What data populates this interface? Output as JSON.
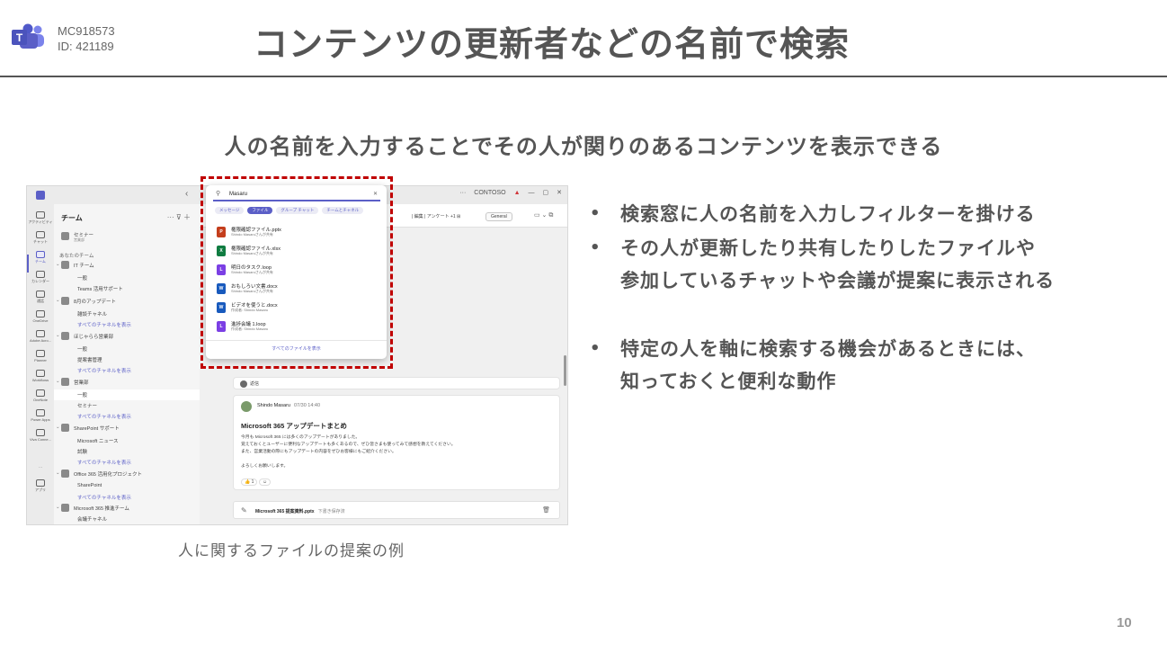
{
  "header": {
    "message_center_id": "MC918573",
    "roadmap_id": "ID: 421189",
    "title": "コンテンツの更新者などの名前で検索"
  },
  "subtitle": "人の名前を入力することでその人が関りのあるコンテンツを表示できる",
  "bullets": [
    {
      "lines": [
        "検索窓に人の名前を入力しフィルターを掛ける"
      ]
    },
    {
      "lines": [
        "その人が更新したり共有したりしたファイルや",
        "参加しているチャットや会議が提案に表示される"
      ]
    },
    {
      "lines": [
        "特定の人を軸に検索する機会があるときには、",
        "知っておくと便利な動作"
      ]
    }
  ],
  "caption": "人に関するファイルの提案の例",
  "page_number": "10",
  "colors": {
    "teams_purple": "#5b5fc7",
    "highlight_red": "#c00000",
    "heading_gray": "#555555"
  },
  "screenshot": {
    "titlebar": {
      "back": "‹",
      "more": "···",
      "tenant": "CONTOSO",
      "warn": "▲"
    },
    "rail": [
      {
        "label": "アクティビティ",
        "icon": "bell-icon"
      },
      {
        "label": "チャット",
        "icon": "chat-icon"
      },
      {
        "label": "チーム",
        "icon": "teams-icon"
      },
      {
        "label": "カレンダー",
        "icon": "calendar-icon"
      },
      {
        "label": "通話",
        "icon": "phone-icon"
      },
      {
        "label": "OneDrive",
        "icon": "cloud-icon"
      },
      {
        "label": "Adobe Acro...",
        "icon": "acrobat-icon"
      },
      {
        "label": "Planner",
        "icon": "planner-icon"
      },
      {
        "label": "Workflows",
        "icon": "workflow-icon"
      },
      {
        "label": "OneNote",
        "icon": "onenote-icon"
      },
      {
        "label": "Power Apps",
        "icon": "powerapps-icon"
      },
      {
        "label": "Viva Conne...",
        "icon": "viva-icon"
      },
      {
        "label": "アプリ",
        "icon": "apps-icon"
      }
    ],
    "team_list": {
      "heading": "チーム",
      "tools": "··· ⊽ ＋",
      "top_item": {
        "name": "セミナー",
        "sub": "営業部"
      },
      "group_label": "あなたのチーム",
      "teams": [
        {
          "name": "IT チーム",
          "channels": [
            "一般",
            "Teams 活用サポート"
          ],
          "all": ""
        },
        {
          "name": "8月のアップデート",
          "channels": [
            "雑談チャネル"
          ],
          "all": "すべてのチャネルを表示"
        },
        {
          "name": "ほじゃらら営業部",
          "channels": [
            "一般",
            "提案書管理"
          ],
          "all": "すべてのチャネルを表示"
        },
        {
          "name": "営業部",
          "channels": [
            "一般",
            "セミナー"
          ],
          "all": "すべてのチャネルを表示"
        },
        {
          "name": "SharePoint サポート",
          "channels": [
            "Microsoft ニュース",
            "試験"
          ],
          "all": "すべてのチャネルを表示"
        },
        {
          "name": "Office 365 活用化プロジェクト",
          "channels": [
            "SharePoint"
          ],
          "all": "すべてのチャネルを表示"
        },
        {
          "name": "Microsoft 365 推進チーム",
          "channels": [
            "会議チャネル"
          ],
          "all": "すべてのチャネルを表示"
        }
      ]
    },
    "channel_header": {
      "name": "一般",
      "tabs": "| 編集 | アンケート +1 ⊞",
      "general_button": "General",
      "icons": "▭ ⌄ ⧉"
    },
    "search": {
      "query": "Masaru",
      "clear": "✕",
      "chips": [
        {
          "label": "メッセージ",
          "active": false
        },
        {
          "label": "ファイル",
          "active": true
        },
        {
          "label": "グループ チャット",
          "active": false
        },
        {
          "label": "チームとチャネル",
          "active": false
        }
      ],
      "results": [
        {
          "type": "P",
          "color": "#c43e1c",
          "name": "権限確認ファイル.pptx",
          "sub": "Shindo Masaruさんが共有"
        },
        {
          "type": "X",
          "color": "#107c41",
          "name": "権限確認ファイル.xlsx",
          "sub": "Shindo Masaruさんが共有"
        },
        {
          "type": "L",
          "color": "#7b3fe4",
          "name": "明日のタスク.loop",
          "sub": "Shindo Masaruさんが共有"
        },
        {
          "type": "W",
          "color": "#185abd",
          "name": "おもしろい文書.docx",
          "sub": "Shindo Masaruさんが共有"
        },
        {
          "type": "W",
          "color": "#185abd",
          "name": "ビデオを使うと.docx",
          "sub": "作成者: Shindo Masaru"
        },
        {
          "type": "L",
          "color": "#7b3fe4",
          "name": "進捗会議 1.loop",
          "sub": "作成者: Shindo Masaru"
        }
      ],
      "show_all": "すべてのファイルを表示"
    },
    "post_reply": "返信",
    "post": {
      "author": "Shindo Masaru",
      "time": "07/30 14:40",
      "title": "Microsoft 365 アップデートまとめ",
      "lines": [
        "今月も Microsoft 365 には多くのアップデートがありました。",
        "覚えておくとユーザーに便利なアップデートも多くあるので、ぜひ皆さまも使ってみて感想を教えてください。",
        "また、営業活動の際にもアップデートの内容をぜひお客様にもご紹介ください。",
        "",
        "よろしくお願いします。"
      ],
      "reactions": [
        "👍 1",
        "☺"
      ]
    },
    "compose": {
      "icon": "✎",
      "file": "Microsoft 365 提案資料.pptx",
      "note": "下書き保存済",
      "trash": "🗑"
    }
  }
}
